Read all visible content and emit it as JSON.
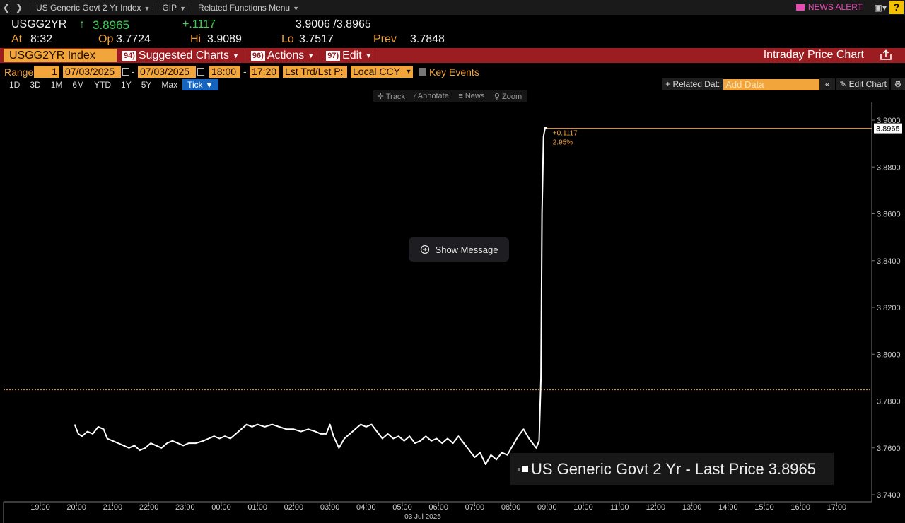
{
  "topbar": {
    "security_menu": "US Generic Govt 2 Yr Index",
    "gip": "GIP",
    "related": "Related Functions Menu",
    "news_alert": "NEWS ALERT",
    "help": "?"
  },
  "quote": {
    "ticker": "USGG2YR",
    "last": "3.8965",
    "change": "+.1117",
    "bid_ask": "3.9006 /3.8965",
    "at_label": "At",
    "at_time": "8:32",
    "op_label": "Op",
    "open": "3.7724",
    "hi_label": "Hi",
    "high": "3.9089",
    "lo_label": "Lo",
    "low": "3.7517",
    "prev_label": "Prev",
    "prev": "3.7848",
    "up_color": "#3ecf5a",
    "accent_color": "#f3a23a"
  },
  "function_bar": {
    "security": "USGG2YR Index",
    "items": [
      {
        "num": "94)",
        "label": "Suggested Charts"
      },
      {
        "num": "96)",
        "label": "Actions"
      },
      {
        "num": "97)",
        "label": "Edit"
      }
    ],
    "title": "Intraday Price Chart",
    "bar_color": "#9b1c21"
  },
  "range": {
    "label": "Range",
    "period_num": "1",
    "start_date": "07/03/2025",
    "end_date": "07/03/2025",
    "start_time": "18:00",
    "end_time": "17:20",
    "price_type": "Lst Trd/Lst P:",
    "currency": "Local CCY",
    "key_events": "Key Events"
  },
  "periods": [
    "1D",
    "3D",
    "1M",
    "6M",
    "YTD",
    "1Y",
    "5Y",
    "Max",
    "Tick ▼"
  ],
  "active_period": 8,
  "related": {
    "label": "+ Related Dat:",
    "placeholder": "Add Data",
    "edit_chart": "Edit Chart"
  },
  "chart_tools": [
    "Track",
    "Annotate",
    "News",
    "Zoom"
  ],
  "show_message": "Show Message",
  "legend": {
    "text": "US Generic Govt 2 Yr - Last Price",
    "value": "3.8965"
  },
  "chart_data": {
    "type": "line",
    "title": "",
    "xlabel": "03 Jul 2025",
    "ylabel": "",
    "ylim": [
      3.74,
      3.905
    ],
    "y_ticks": [
      "3.9000",
      "3.8800",
      "3.8600",
      "3.8400",
      "3.8200",
      "3.8000",
      "3.7800",
      "3.7600",
      "3.7400"
    ],
    "x_ticks": [
      "19:00",
      "20:00",
      "21:00",
      "22:00",
      "23:00",
      "00:00",
      "01:00",
      "02:00",
      "03:00",
      "04:00",
      "05:00",
      "06:00",
      "07:00",
      "08:00",
      "09:00",
      "10:00",
      "11:00",
      "12:00",
      "13:00",
      "14:00",
      "15:00",
      "16:00",
      "17:00"
    ],
    "prev_close": 3.7848,
    "last_price": 3.8965,
    "last_label": "3.8965",
    "change_label": "+0.1117",
    "change_pct_label": "2.95%",
    "series": [
      {
        "name": "US Generic Govt 2 Yr - Last Price",
        "color": "#ffffff",
        "points": [
          [
            19.95,
            3.77
          ],
          [
            20.05,
            3.766
          ],
          [
            20.15,
            3.765
          ],
          [
            20.3,
            3.767
          ],
          [
            20.45,
            3.766
          ],
          [
            20.6,
            3.769
          ],
          [
            20.75,
            3.768
          ],
          [
            20.85,
            3.764
          ],
          [
            21.0,
            3.763
          ],
          [
            21.15,
            3.762
          ],
          [
            21.3,
            3.761
          ],
          [
            21.45,
            3.76
          ],
          [
            21.6,
            3.761
          ],
          [
            21.75,
            3.759
          ],
          [
            21.9,
            3.76
          ],
          [
            22.05,
            3.762
          ],
          [
            22.2,
            3.761
          ],
          [
            22.35,
            3.76
          ],
          [
            22.5,
            3.762
          ],
          [
            22.65,
            3.763
          ],
          [
            22.8,
            3.762
          ],
          [
            22.95,
            3.761
          ],
          [
            23.1,
            3.762
          ],
          [
            23.3,
            3.762
          ],
          [
            23.5,
            3.763
          ],
          [
            23.65,
            3.764
          ],
          [
            23.8,
            3.765
          ],
          [
            23.95,
            3.764
          ],
          [
            24.1,
            3.765
          ],
          [
            24.25,
            3.764
          ],
          [
            24.4,
            3.766
          ],
          [
            24.55,
            3.768
          ],
          [
            24.7,
            3.77
          ],
          [
            24.85,
            3.769
          ],
          [
            25.0,
            3.77
          ],
          [
            25.2,
            3.769
          ],
          [
            25.4,
            3.77
          ],
          [
            25.6,
            3.769
          ],
          [
            25.8,
            3.768
          ],
          [
            26.0,
            3.768
          ],
          [
            26.2,
            3.767
          ],
          [
            26.4,
            3.768
          ],
          [
            26.6,
            3.767
          ],
          [
            26.75,
            3.766
          ],
          [
            26.9,
            3.766
          ],
          [
            27.0,
            3.77
          ],
          [
            27.1,
            3.765
          ],
          [
            27.25,
            3.76
          ],
          [
            27.4,
            3.764
          ],
          [
            27.55,
            3.766
          ],
          [
            27.7,
            3.768
          ],
          [
            27.85,
            3.77
          ],
          [
            28.0,
            3.769
          ],
          [
            28.15,
            3.77
          ],
          [
            28.3,
            3.767
          ],
          [
            28.45,
            3.764
          ],
          [
            28.6,
            3.766
          ],
          [
            28.75,
            3.764
          ],
          [
            28.9,
            3.765
          ],
          [
            29.05,
            3.763
          ],
          [
            29.2,
            3.765
          ],
          [
            29.35,
            3.762
          ],
          [
            29.5,
            3.763
          ],
          [
            29.65,
            3.765
          ],
          [
            29.8,
            3.763
          ],
          [
            29.95,
            3.764
          ],
          [
            30.1,
            3.762
          ],
          [
            30.25,
            3.764
          ],
          [
            30.4,
            3.762
          ],
          [
            30.55,
            3.765
          ],
          [
            30.7,
            3.762
          ],
          [
            30.85,
            3.759
          ],
          [
            31.0,
            3.756
          ],
          [
            31.15,
            3.758
          ],
          [
            31.3,
            3.753
          ],
          [
            31.45,
            3.757
          ],
          [
            31.6,
            3.755
          ],
          [
            31.75,
            3.758
          ],
          [
            31.9,
            3.757
          ],
          [
            32.05,
            3.761
          ],
          [
            32.2,
            3.765
          ],
          [
            32.35,
            3.768
          ],
          [
            32.5,
            3.764
          ],
          [
            32.6,
            3.762
          ],
          [
            32.7,
            3.76
          ],
          [
            32.78,
            3.763
          ],
          [
            32.83,
            3.79
          ],
          [
            32.86,
            3.86
          ],
          [
            32.9,
            3.893
          ],
          [
            32.95,
            3.897
          ],
          [
            33.0,
            3.8965
          ]
        ]
      }
    ]
  }
}
